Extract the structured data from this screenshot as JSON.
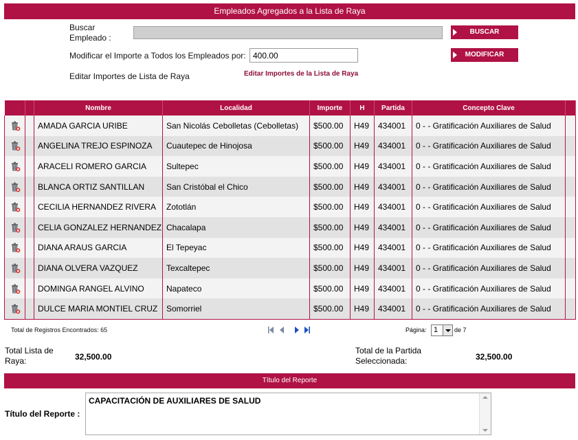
{
  "header": {
    "title": "Empleados Agregados a la Lista de Raya"
  },
  "search": {
    "label": "Buscar Empleado :",
    "value": "",
    "button": "BUSCAR"
  },
  "modify": {
    "label": "Modificar el Importe a Todos los Empleados por:",
    "value": "400.00",
    "button": "MODIFICAR"
  },
  "edit": {
    "label": "Editar Importes de Lista de Raya",
    "link": "Editar Importes de la Lista de Raya"
  },
  "table": {
    "columns": [
      "Nombre",
      "Localidad",
      "Importe",
      "H",
      "Partida",
      "Concepto Clave"
    ],
    "rows": [
      {
        "nombre": "AMADA GARCIA URIBE",
        "localidad": "San Nicolás Cebolletas (Cebolletas)",
        "importe": "$500.00",
        "h": "H49",
        "partida": "434001",
        "concepto": "0 - - Gratificación Auxiliares de Salud"
      },
      {
        "nombre": "ANGELINA TREJO ESPINOZA",
        "localidad": "Cuautepec de Hinojosa",
        "importe": "$500.00",
        "h": "H49",
        "partida": "434001",
        "concepto": "0 - - Gratificación Auxiliares de Salud"
      },
      {
        "nombre": "ARACELI ROMERO GARCIA",
        "localidad": "Sultepec",
        "importe": "$500.00",
        "h": "H49",
        "partida": "434001",
        "concepto": "0 - - Gratificación Auxiliares de Salud"
      },
      {
        "nombre": "BLANCA ORTIZ SANTILLAN",
        "localidad": "San Cristóbal el Chico",
        "importe": "$500.00",
        "h": "H49",
        "partida": "434001",
        "concepto": "0 - - Gratificación Auxiliares de Salud"
      },
      {
        "nombre": "CECILIA HERNANDEZ RIVERA",
        "localidad": "Zototlán",
        "importe": "$500.00",
        "h": "H49",
        "partida": "434001",
        "concepto": "0 - - Gratificación Auxiliares de Salud"
      },
      {
        "nombre": "CELIA GONZALEZ HERNANDEZ",
        "localidad": "Chacalapa",
        "importe": "$500.00",
        "h": "H49",
        "partida": "434001",
        "concepto": "0 - - Gratificación Auxiliares de Salud"
      },
      {
        "nombre": "DIANA ARAUS GARCIA",
        "localidad": "El Tepeyac",
        "importe": "$500.00",
        "h": "H49",
        "partida": "434001",
        "concepto": "0 - - Gratificación Auxiliares de Salud"
      },
      {
        "nombre": "DIANA OLVERA VAZQUEZ",
        "localidad": "Texcaltepec",
        "importe": "$500.00",
        "h": "H49",
        "partida": "434001",
        "concepto": "0 - - Gratificación Auxiliares de Salud"
      },
      {
        "nombre": "DOMINGA RANGEL ALVINO",
        "localidad": "Napateco",
        "importe": "$500.00",
        "h": "H49",
        "partida": "434001",
        "concepto": "0 - - Gratificación Auxiliares de Salud"
      },
      {
        "nombre": "DULCE MARIA MONTIEL CRUZ",
        "localidad": "Somorriel",
        "importe": "$500.00",
        "h": "H49",
        "partida": "434001",
        "concepto": "0 - - Gratificación Auxiliares de Salud"
      }
    ]
  },
  "pager": {
    "total_text": "Total de Registros Encontrados: 65",
    "page_label": "Página:",
    "page": "1",
    "of_text": "de 7"
  },
  "totals": {
    "lista_label": "Total Lista de Raya:",
    "lista_value": "32,500.00",
    "partida_label": "Total de la Partida Seleccionada:",
    "partida_value": "32,500.00"
  },
  "report": {
    "bar_title": "Título del Reporte",
    "label": "Título del Reporte :",
    "value": "CAPACITACIÓN DE AUXILIARES DE SALUD"
  },
  "colors": {
    "accent": "#b01245",
    "row_odd": "#f3f3f3",
    "row_even": "#e2e2e2"
  },
  "icons": {
    "row_action": "trash-delete-icon",
    "nav": [
      "first-page-icon",
      "prev-page-icon",
      "next-page-icon",
      "last-page-icon"
    ]
  }
}
